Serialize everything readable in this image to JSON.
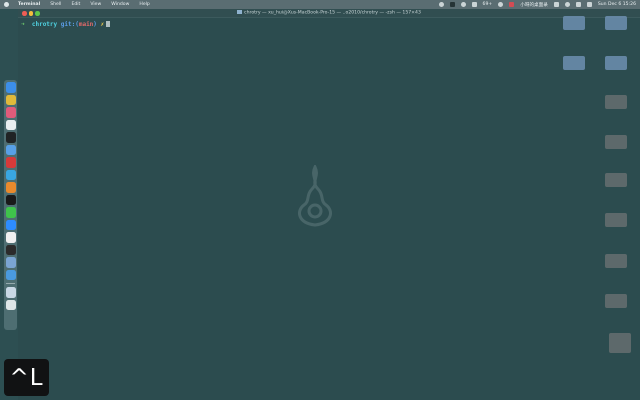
{
  "menubar": {
    "app_name": "Terminal",
    "items": [
      "Shell",
      "Edit",
      "View",
      "Window",
      "Help"
    ],
    "status_text": "小呀的桌面录",
    "battery": "69+",
    "clock": "Sun Dec 6  15:26"
  },
  "window": {
    "title": "chrotry — xu_hui@Xus-MacBook-Pro-15 — ..o2010/chrotry — -zsh — 157×43"
  },
  "terminal": {
    "prompt_arrow": "➜",
    "directory": "chrotry",
    "git_label": "git:(",
    "branch": "main",
    "git_close": ")",
    "dirty_mark": "✗"
  },
  "dock": {
    "icons": [
      "finder-icon",
      "chrome-icon",
      "cleanmaster-icon",
      "files-icon",
      "terminal-icon",
      "pointer-icon",
      "netease-music-icon",
      "telegram-icon",
      "sublime-icon",
      "pycharm-icon",
      "wechat-icon",
      "zoom-icon",
      "photos-icon",
      "notes-icon",
      "preview-icon",
      "safari-icon",
      "downloads-icon",
      "trash-icon"
    ],
    "colors": {
      "finder": "#3c8ee8",
      "chrome": "#e0b93a",
      "cleanmaster": "#e05b7a",
      "files": "#e9eef0",
      "terminal": "#202324",
      "pointer": "#58a0e6",
      "netease": "#d63a3a",
      "telegram": "#39a7e2",
      "sublime": "#e98a2d",
      "pycharm": "#1a1a1a",
      "wechat": "#3fc34b",
      "zoom": "#2d8cff",
      "photos": "#f0f0f0",
      "notes": "#2b2b2b",
      "preview": "#7aa5d3",
      "safari": "#4a9adf",
      "downloads": "#c9d8e5",
      "trash": "#dfe6e8"
    }
  },
  "keystroke": {
    "text": "^L"
  }
}
